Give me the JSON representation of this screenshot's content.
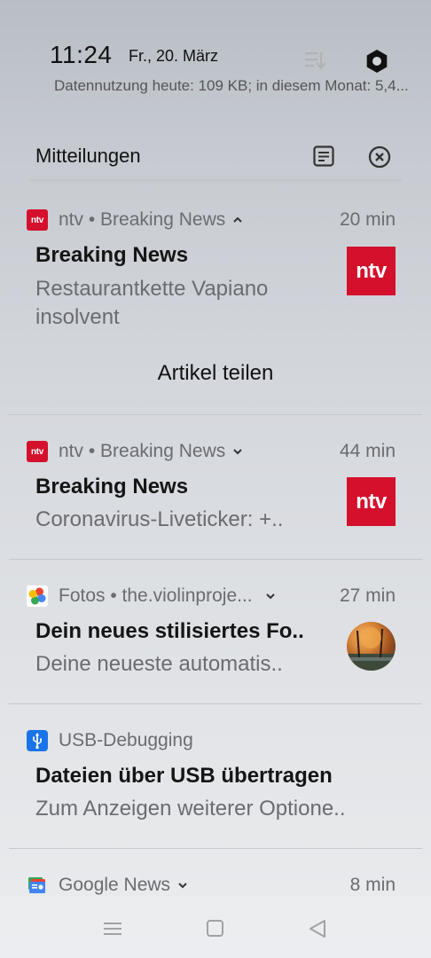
{
  "status_bar": {
    "time": "11:24",
    "date": "Fr., 20. März",
    "data_usage": "Datennutzung heute: 109 KB; in diesem Monat: 5,4..."
  },
  "shade": {
    "title": "Mitteilungen"
  },
  "notifications": [
    {
      "app_icon": "ntv",
      "app": "ntv • Breaking News",
      "time": "20 min",
      "title": "Breaking News",
      "body": "Restaurantkette Vapiano insolvent",
      "thumbnail": "ntv",
      "action": "Artikel teilen",
      "expanded": true
    },
    {
      "app_icon": "ntv",
      "app": "ntv • Breaking News",
      "time": "44 min",
      "title": "Breaking News",
      "body": "Coronavirus-Liveticker: +..",
      "thumbnail": "ntv",
      "expanded": false
    },
    {
      "app_icon": "photos-pinwheel-icon",
      "app": "Fotos • the.violinproje...",
      "time": "27 min",
      "title": "Dein neues stilisiertes Fo..",
      "body": "Deine neueste automatis..",
      "thumbnail": "autumn-photo",
      "expanded": false
    },
    {
      "app_icon": "usb-icon",
      "app": "USB-Debugging",
      "time": "",
      "title": "Dateien über USB übertragen",
      "body": "Zum Anzeigen weiterer Optione..",
      "expanded": false
    },
    {
      "app_icon": "google-news-icon",
      "app": "Google News",
      "time": "8 min",
      "expanded": false
    }
  ],
  "colors": {
    "ntv_red": "#d4102d",
    "usb_blue": "#1a73e8",
    "secondary_text": "#6a6c70"
  }
}
